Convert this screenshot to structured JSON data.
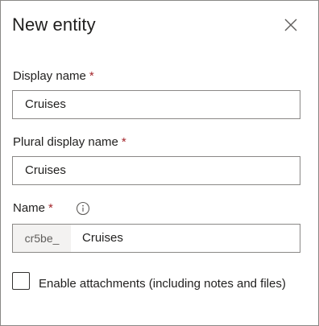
{
  "panel": {
    "title": "New entity",
    "close_icon": "close-icon"
  },
  "fields": {
    "display_name": {
      "label": "Display name",
      "required_marker": "*",
      "value": "Cruises"
    },
    "plural_display_name": {
      "label": "Plural display name",
      "required_marker": "*",
      "value": "Cruises"
    },
    "name": {
      "label": "Name",
      "required_marker": "*",
      "info_icon": "info-icon",
      "prefix": "cr5be_",
      "value": "Cruises"
    }
  },
  "attachments": {
    "checked": false,
    "label": "Enable attachments (including notes and files)"
  },
  "colors": {
    "required": "#a4262c",
    "border": "#8a8886",
    "prefix_bg": "#f3f2f1"
  }
}
